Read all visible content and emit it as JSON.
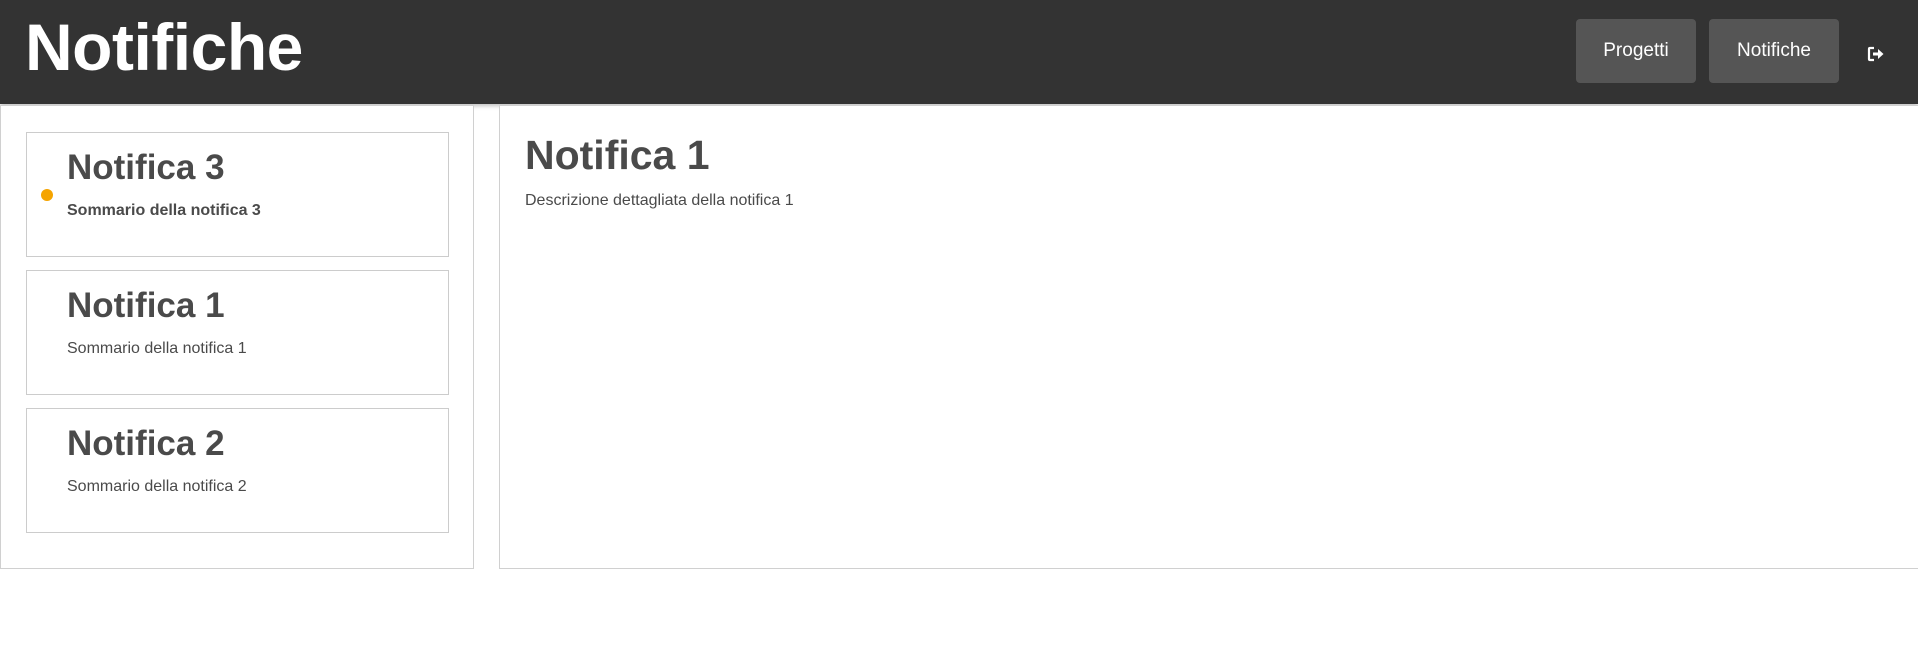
{
  "header": {
    "title": "Notifiche",
    "nav": [
      {
        "label": "Progetti"
      },
      {
        "label": "Notifiche"
      }
    ],
    "logout_icon": "sign-out-icon"
  },
  "notifications": [
    {
      "title": "Notifica 3",
      "summary": "Sommario della notifica 3",
      "unread": true
    },
    {
      "title": "Notifica 1",
      "summary": "Sommario della notifica 1",
      "unread": false
    },
    {
      "title": "Notifica 2",
      "summary": "Sommario della notifica 2",
      "unread": false
    }
  ],
  "detail": {
    "title": "Notifica 1",
    "description": "Descrizione dettagliata della notifica 1"
  },
  "colors": {
    "header_bg": "#333333",
    "button_bg": "#555555",
    "unread_dot": "#f5a400",
    "text": "#4a4a4a"
  }
}
